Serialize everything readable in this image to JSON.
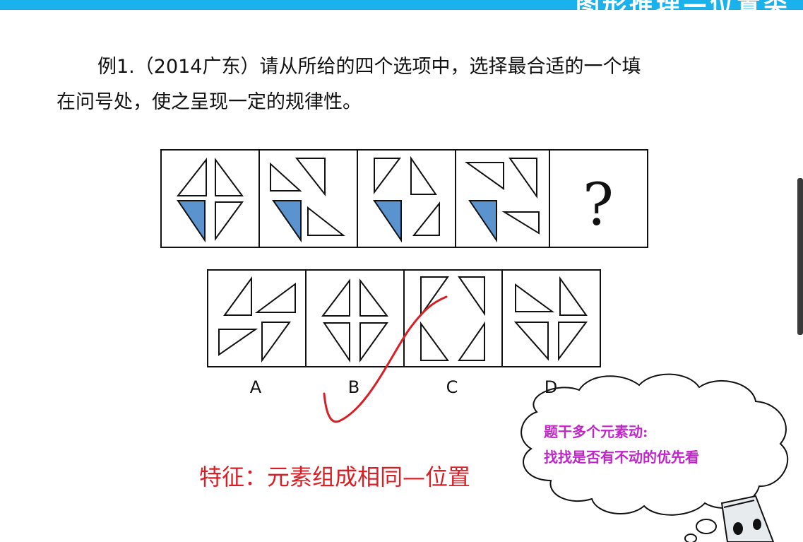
{
  "header": {
    "title": "图形推理—位置类",
    "bar_color": "#19b2ec"
  },
  "question": {
    "line1": "例1.（2014广东）请从所给的四个选项中，选择最合适的一个填",
    "line2": "在问号处，使之呈现一定的规律性。"
  },
  "puzzle": {
    "question_mark": "?",
    "highlight_color": "#5b93cf"
  },
  "options": [
    {
      "label": "A"
    },
    {
      "label": "B"
    },
    {
      "label": "C"
    },
    {
      "label": "D"
    }
  ],
  "annotation": {
    "feature": "特征：元素组成相同—位置",
    "check_color": "#d81f26"
  },
  "bubble": {
    "line1": "题干多个元素动:",
    "line2": "找找是否有不动的优先看",
    "text_color": "#c026c9"
  }
}
